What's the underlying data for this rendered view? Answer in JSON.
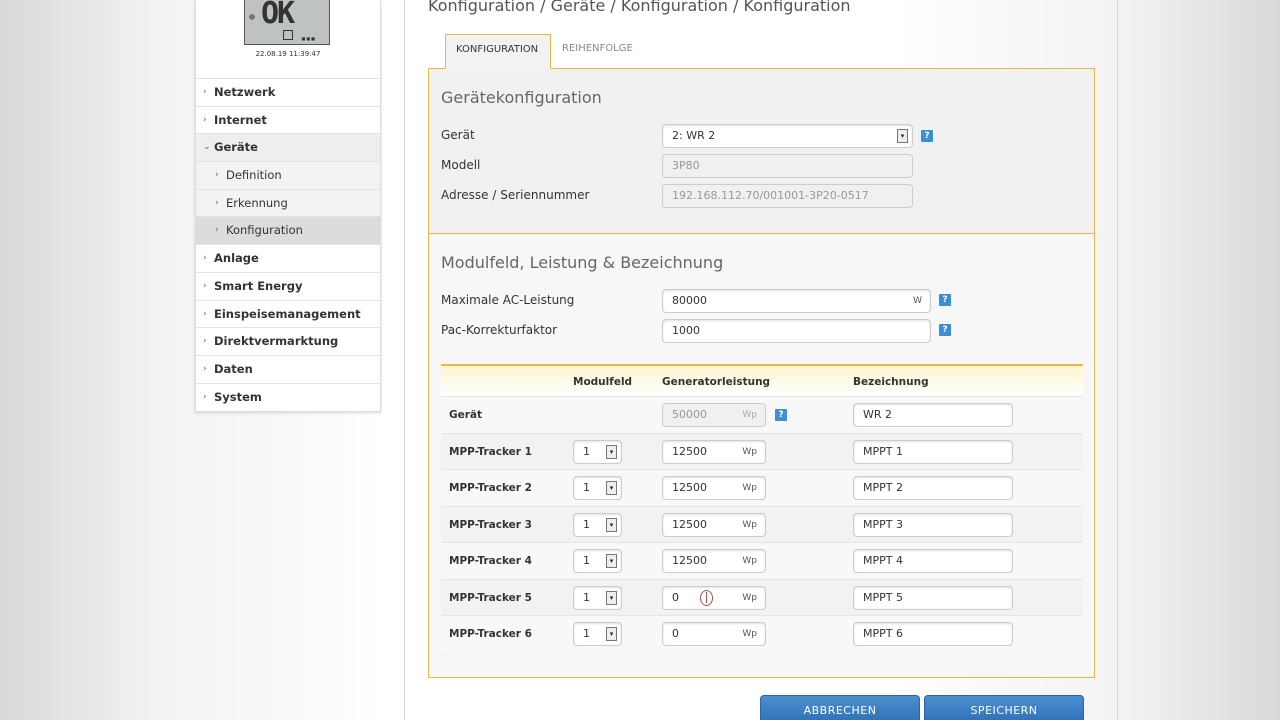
{
  "breadcrumb": "Konfiguration / Geräte / Konfiguration / Konfiguration",
  "device": {
    "lcd_text": "OK",
    "lcd_dots": "▪▪▪",
    "timestamp": "22.08.19 11:39:47"
  },
  "sidebar": {
    "items": [
      {
        "label": "Netzwerk",
        "chev": "›"
      },
      {
        "label": "Internet",
        "chev": "›"
      },
      {
        "label": "Geräte",
        "chev": "⌄"
      },
      {
        "label": "Definition",
        "chev": "›"
      },
      {
        "label": "Erkennung",
        "chev": "›"
      },
      {
        "label": "Konfiguration",
        "chev": "›"
      },
      {
        "label": "Anlage",
        "chev": "›"
      },
      {
        "label": "Smart Energy",
        "chev": "›"
      },
      {
        "label": "Einspeisemanagement",
        "chev": "›"
      },
      {
        "label": "Direktvermarktung",
        "chev": "›"
      },
      {
        "label": "Daten",
        "chev": "›"
      },
      {
        "label": "System",
        "chev": "›"
      }
    ]
  },
  "tabs": {
    "konfiguration": "KONFIGURATION",
    "reihenfolge": "REIHENFOLGE"
  },
  "section1": {
    "title": "Gerätekonfiguration",
    "geraet_label": "Gerät",
    "geraet_value": "2: WR 2",
    "modell_label": "Modell",
    "modell_value": "3P80",
    "adresse_label": "Adresse / Seriennummer",
    "adresse_value": "192.168.112.70/001001-3P20-0517"
  },
  "section2": {
    "title": "Modulfeld, Leistung & Bezeichnung",
    "max_ac_label": "Maximale AC-Leistung",
    "max_ac_value": "80000",
    "max_ac_unit": "W",
    "pac_label": "Pac-Korrekturfaktor",
    "pac_value": "1000"
  },
  "help_glyph": "?",
  "select_glyph": "▾",
  "table": {
    "headers": {
      "modulfeld": "Modulfeld",
      "generatorleistung": "Generatorleistung",
      "bezeichnung": "Bezeichnung"
    },
    "unit": "Wp",
    "rows": [
      {
        "label": "Gerät",
        "modulfeld": "",
        "leistung": "50000",
        "bezeichnung": "WR 2"
      },
      {
        "label": "MPP-Tracker 1",
        "modulfeld": "1",
        "leistung": "12500",
        "bezeichnung": "MPPT 1"
      },
      {
        "label": "MPP-Tracker 2",
        "modulfeld": "1",
        "leistung": "12500",
        "bezeichnung": "MPPT 2"
      },
      {
        "label": "MPP-Tracker 3",
        "modulfeld": "1",
        "leistung": "12500",
        "bezeichnung": "MPPT 3"
      },
      {
        "label": "MPP-Tracker 4",
        "modulfeld": "1",
        "leistung": "12500",
        "bezeichnung": "MPPT 4"
      },
      {
        "label": "MPP-Tracker 5",
        "modulfeld": "1",
        "leistung": "0",
        "bezeichnung": "MPPT 5"
      },
      {
        "label": "MPP-Tracker 6",
        "modulfeld": "1",
        "leistung": "0",
        "bezeichnung": "MPPT 6"
      }
    ]
  },
  "buttons": {
    "abbrechen": "ABBRECHEN",
    "speichern": "SPEICHERN"
  }
}
